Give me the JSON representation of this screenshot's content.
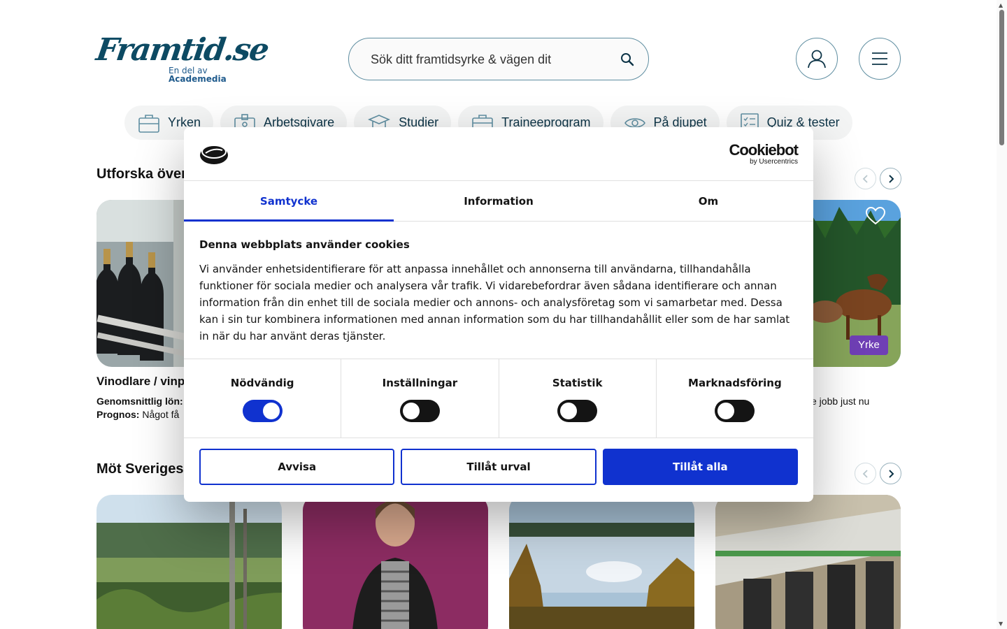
{
  "header": {
    "logo_text": "Framtid.se",
    "logo_sub1": "En del av",
    "logo_sub2": "Academedia",
    "search_placeholder": "Sök ditt framtidsyrke & vägen dit"
  },
  "nav": {
    "items": [
      {
        "label": "Yrken",
        "icon": "briefcase-icon"
      },
      {
        "label": "Arbetsgivare",
        "icon": "badge-icon"
      },
      {
        "label": "Studier",
        "icon": "graduation-cap-icon"
      },
      {
        "label": "Traineeprogram",
        "icon": "briefcase-icon"
      },
      {
        "label": "På djupet",
        "icon": "eye-icon"
      },
      {
        "label": "Quiz & tester",
        "icon": "checklist-icon"
      }
    ]
  },
  "sections": {
    "explore_title": "Utforska över",
    "meet_title": "Möt Sveriges"
  },
  "cards": {
    "first_title": "Vinodlare / vinp",
    "salary_label": "Genomsnittlig lön:",
    "prognosis_label": "Prognos:",
    "prognosis_value": "Något få",
    "right_meta": "e jobb just nu",
    "badge": "Yrke"
  },
  "cookie": {
    "brand": "Cookiebot",
    "brand_sub": "by Usercentrics",
    "tabs": [
      "Samtycke",
      "Information",
      "Om"
    ],
    "heading": "Denna webbplats använder cookies",
    "text": "Vi använder enhetsidentifierare för att anpassa innehållet och annonserna till användarna, tillhandahålla funktioner för sociala medier och analysera vår trafik. Vi vidarebefordrar även sådana identifierare och annan information från din enhet till de sociala medier och annons- och analysföretag som vi samarbetar med. Dessa kan i sin tur kombinera informationen med annan information som du har tillhandahållit eller som de har samlat in när du har använt deras tjänster.",
    "toggles": [
      {
        "label": "Nödvändig",
        "on": true
      },
      {
        "label": "Inställningar",
        "on": false
      },
      {
        "label": "Statistik",
        "on": false
      },
      {
        "label": "Marknadsföring",
        "on": false
      }
    ],
    "buttons": {
      "reject": "Avvisa",
      "selection": "Tillåt urval",
      "allow_all": "Tillåt alla"
    }
  },
  "colors": {
    "brand": "#0d4a63",
    "cookie_accent": "#1032cf",
    "badge": "#6f3fb5"
  }
}
